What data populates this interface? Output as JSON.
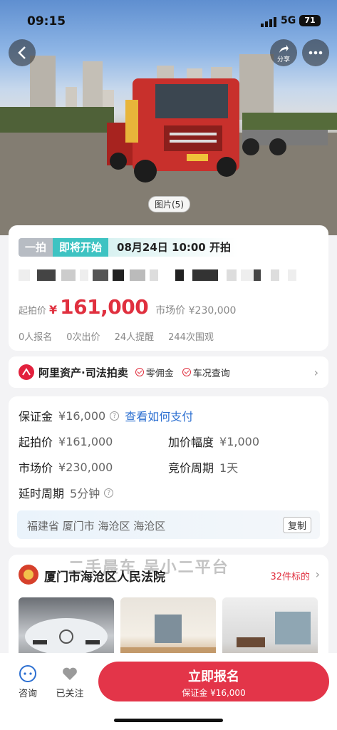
{
  "status_bar": {
    "time": "09:15",
    "network": "5G",
    "battery": "71"
  },
  "hero": {
    "share_label": "分享",
    "photo_badge": "图片(5)"
  },
  "auction": {
    "tag_round": "一拍",
    "tag_status": "即将开始",
    "start_time": "08月24日 10:00 开拍",
    "start_price_label": "起拍价",
    "currency": "¥",
    "start_price": "161,000",
    "market_price": "市场价 ¥230,000",
    "stats": [
      "0人报名",
      "0次出价",
      "24人提醒",
      "244次围观"
    ]
  },
  "platform": {
    "name": "阿里资产·司法拍卖",
    "badges": [
      "零佣金",
      "车况查询"
    ]
  },
  "details": {
    "deposit_label": "保证金",
    "deposit_value": "¥16,000",
    "deposit_link": "查看如何支付",
    "start_price_label": "起拍价",
    "start_price_value": "¥161,000",
    "increment_label": "加价幅度",
    "increment_value": "¥1,000",
    "market_price_label": "市场价",
    "market_price_value": "¥230,000",
    "bid_cycle_label": "竞价周期",
    "bid_cycle_value": "1天",
    "delay_label": "延时周期",
    "delay_value": "5分钟",
    "address": "福建省 厦门市 海沧区 海沧区",
    "copy_label": "复制"
  },
  "court": {
    "name": "厦门市海沧区人民法院",
    "count": "32件标的",
    "watermark": "二手晨车 吴小二平台"
  },
  "bottom_bar": {
    "consult_label": "咨询",
    "follow_label": "已关注",
    "cta_label": "立即报名",
    "cta_sub": "保证金 ¥16,000"
  },
  "colors": {
    "accent": "#e33549",
    "teal": "#3ec3c2",
    "price_red": "#e0303f"
  }
}
